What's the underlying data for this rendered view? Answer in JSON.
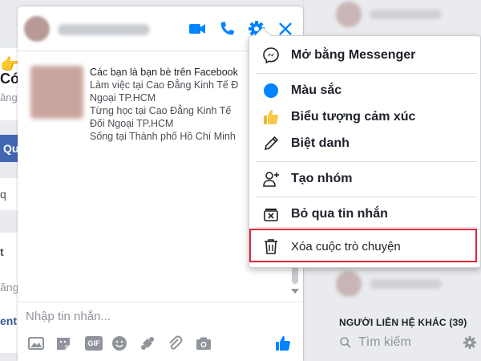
{
  "left_page": {
    "snippets": [
      "Có",
      "ăng",
      "q",
      "t",
      "ăng",
      "ent"
    ],
    "button_label": "Qu"
  },
  "chat": {
    "message_placeholder": "Nhập tin nhắn...",
    "intro_lines": [
      "Các bạn là bạn bè trên Facebook",
      "Làm việc tại Cao Đẳng Kinh Tế Đ",
      "Ngoại TP.HCM",
      "Từng học tại Cao Đẳng Kinh Tế",
      "Đối Ngoại TP.HCM",
      "Sống tại Thành phố Hồ Chí Minh"
    ],
    "header_icons": [
      "video-call-icon",
      "phone-icon",
      "gear-icon",
      "close-icon"
    ],
    "toolbar_icons": [
      "photo-icon",
      "sticker-icon",
      "gif-icon",
      "emoji-icon",
      "game-icon",
      "attachment-icon",
      "camera-icon",
      "thumbs-up-icon"
    ],
    "gif_label": "GIF",
    "accent_color": "#4267b2"
  },
  "menu": {
    "items": [
      {
        "label": "Mở bằng Messenger",
        "icon": "messenger-icon"
      },
      {
        "label": "Màu sắc",
        "icon": "color-dot-icon"
      },
      {
        "label": "Biểu tượng cảm xúc",
        "icon": "thumbs-up-icon"
      },
      {
        "label": "Biệt danh",
        "icon": "pencil-icon"
      },
      {
        "label": "Tạo nhóm",
        "icon": "add-person-icon"
      },
      {
        "label": "Bỏ qua tin nhắn",
        "icon": "ignore-message-icon"
      },
      {
        "label": "Xóa cuộc trò chuyện",
        "icon": "trash-icon"
      }
    ],
    "highlighted_item": "Xóa cuộc trò chuyện",
    "highlight_color": "#e0263e"
  },
  "sidebar": {
    "other_contacts_heading": "NGƯỜI LIÊN HỆ KHÁC (39)",
    "search_placeholder": "Tìm kiếm"
  }
}
